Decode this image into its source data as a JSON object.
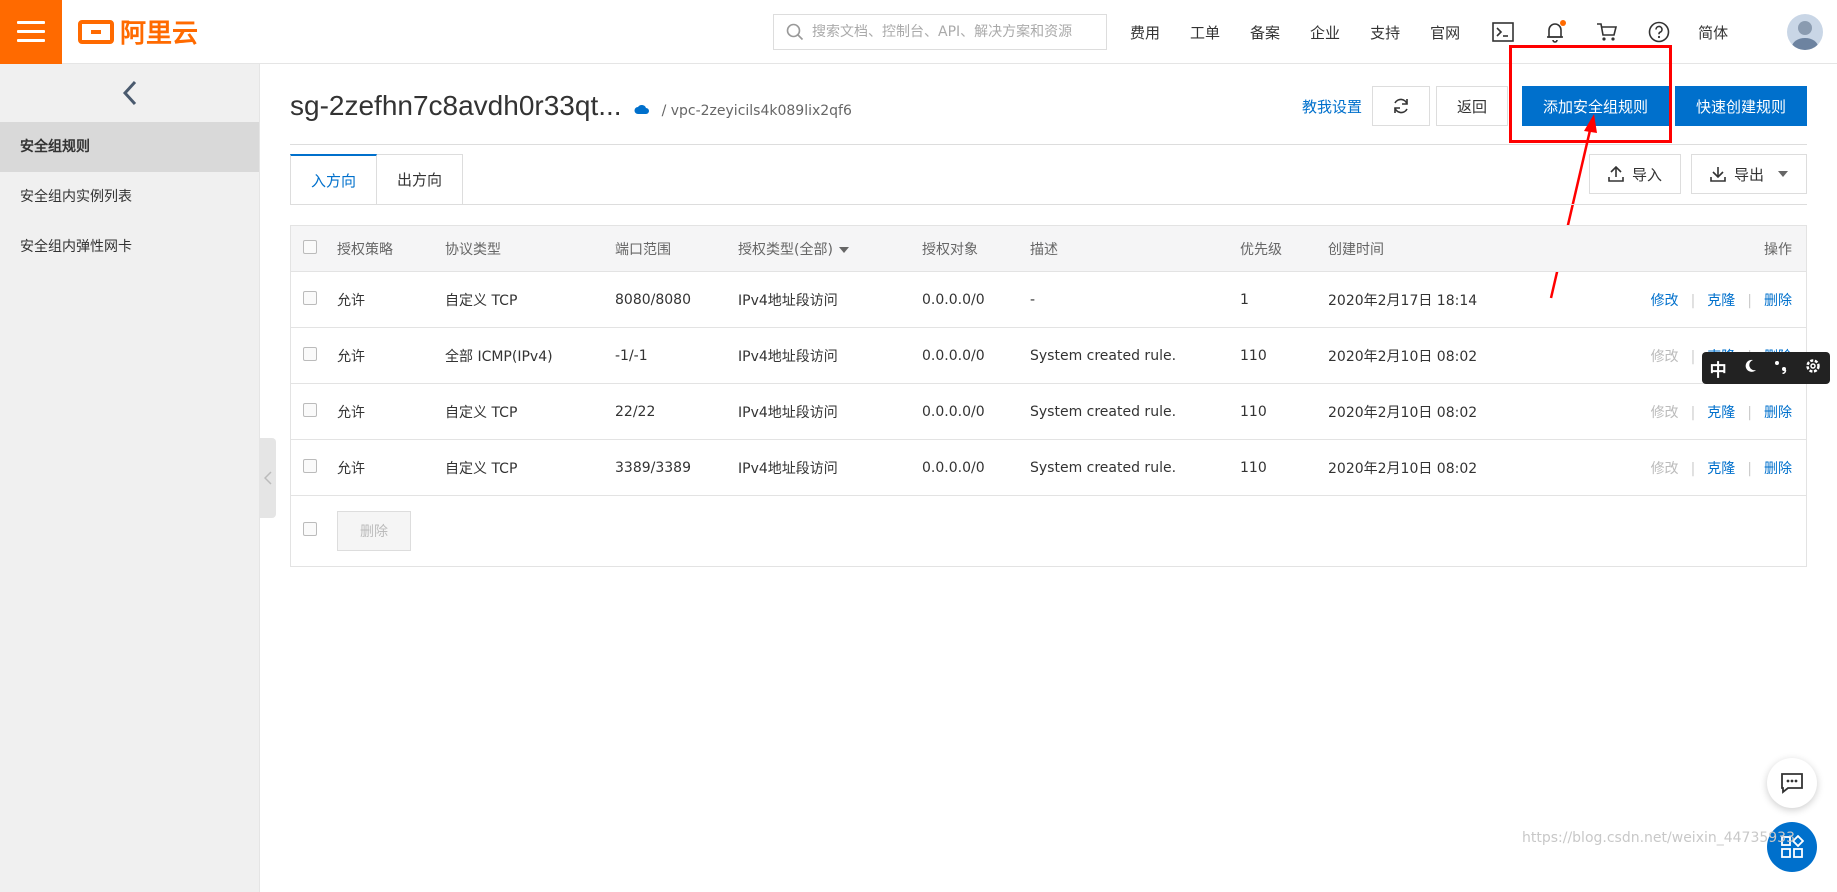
{
  "topbar": {
    "logo_text": "阿里云",
    "search_placeholder": "搜索文档、控制台、API、解决方案和资源",
    "nav": [
      "费用",
      "工单",
      "备案",
      "企业",
      "支持",
      "官网"
    ],
    "lang": "简体",
    "icons": [
      "terminal-icon",
      "bell-icon",
      "cart-icon",
      "help-icon"
    ],
    "accent_color": "#ff6a00"
  },
  "sidebar": {
    "items": [
      {
        "label": "安全组规则"
      },
      {
        "label": "安全组内实例列表"
      },
      {
        "label": "安全组内弹性网卡"
      }
    ]
  },
  "header": {
    "title": "sg-2zefhn7c8avdh0r33qt...",
    "vpc": "/ vpc-2zeyicils4k089lix2qf6",
    "teach_label": "教我设置",
    "back_label": "返回",
    "add_rule_label": "添加安全组规则",
    "quick_create_label": "快速创建规则",
    "primary_color": "#0070cc"
  },
  "tabs": [
    {
      "label": "入方向"
    },
    {
      "label": "出方向"
    }
  ],
  "io": {
    "import_label": "导入",
    "export_label": "导出"
  },
  "table": {
    "headers": [
      "授权策略",
      "协议类型",
      "端口范围",
      "授权类型(全部)",
      "授权对象",
      "描述",
      "优先级",
      "创建时间",
      "操作"
    ],
    "rows": [
      {
        "policy": "允许",
        "protocol": "自定义 TCP",
        "port": "8080/8080",
        "auth_type": "IPv4地址段访问",
        "target": "0.0.0.0/0",
        "desc": "-",
        "priority": "1",
        "created": "2020年2月17日 18:14"
      },
      {
        "policy": "允许",
        "protocol": "全部 ICMP(IPv4)",
        "port": "-1/-1",
        "auth_type": "IPv4地址段访问",
        "target": "0.0.0.0/0",
        "desc": "System created rule.",
        "priority": "110",
        "created": "2020年2月10日 08:02"
      },
      {
        "policy": "允许",
        "protocol": "自定义 TCP",
        "port": "22/22",
        "auth_type": "IPv4地址段访问",
        "target": "0.0.0.0/0",
        "desc": "System created rule.",
        "priority": "110",
        "created": "2020年2月10日 08:02"
      },
      {
        "policy": "允许",
        "protocol": "自定义 TCP",
        "port": "3389/3389",
        "auth_type": "IPv4地址段访问",
        "target": "0.0.0.0/0",
        "desc": "System created rule.",
        "priority": "110",
        "created": "2020年2月10日 08:02"
      }
    ],
    "ops": {
      "edit": "修改",
      "clone": "克隆",
      "delete": "删除"
    },
    "bulk_delete_label": "删除"
  },
  "ime": {
    "mode": "中"
  },
  "watermark": "https://blog.csdn.net/weixin_44735933"
}
